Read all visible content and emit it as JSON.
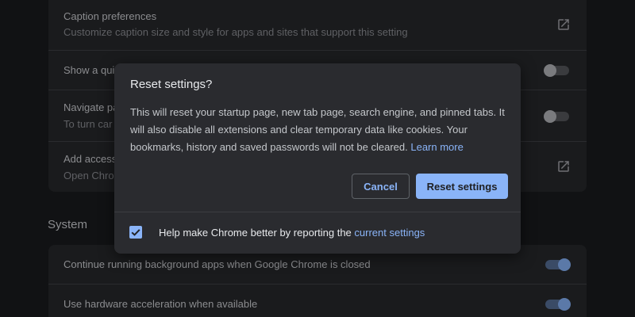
{
  "settings": {
    "accessibility_rows": [
      {
        "title": "Caption preferences",
        "subtitle": "Customize caption size and style for apps and sites that support this setting"
      },
      {
        "title": "Show a qui"
      },
      {
        "title": "Navigate pa",
        "subtitle": "To turn car"
      },
      {
        "title": "Add access",
        "subtitle": "Open Chrom"
      }
    ],
    "system_heading": "System",
    "system_rows": [
      {
        "title": "Continue running background apps when Google Chrome is closed",
        "enabled": true
      },
      {
        "title": "Use hardware acceleration when available",
        "enabled": true
      }
    ]
  },
  "dialog": {
    "title": "Reset settings?",
    "body": "This will reset your startup page, new tab page, search engine, and pinned tabs. It will also disable all extensions and clear temporary data like cookies. Your bookmarks, history and saved passwords will not be cleared.",
    "learn_more": "Learn more",
    "cancel_label": "Cancel",
    "reset_label": "Reset settings",
    "report_text": "Help make Chrome better by reporting the",
    "report_link": "current settings",
    "report_checked": true
  },
  "colors": {
    "accent": "#8ab4f8",
    "dialog_bg": "#2a2b2f",
    "page_bg": "#111214"
  },
  "icons": {
    "external_link": "open-in-new-icon",
    "checkbox": "checkmark-icon"
  }
}
